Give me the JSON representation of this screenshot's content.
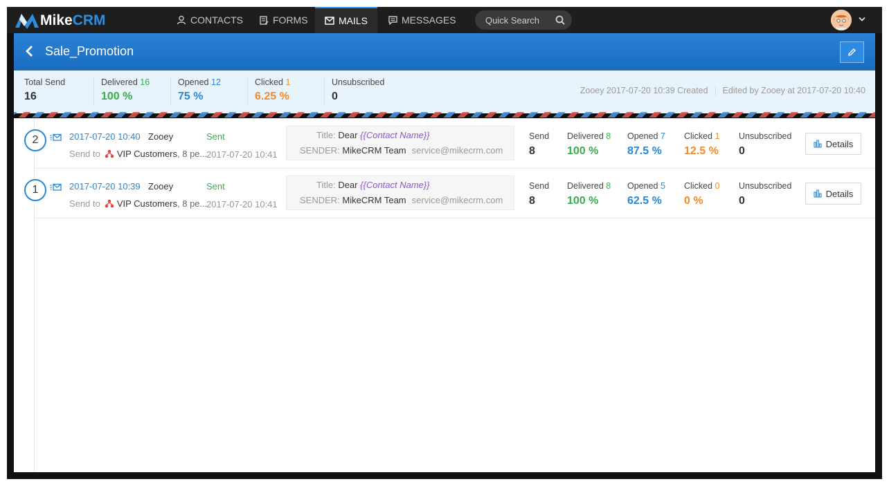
{
  "app": {
    "brand_part1": "Mike",
    "brand_part2": "CRM"
  },
  "nav": {
    "tabs": [
      {
        "label": "CONTACTS",
        "icon": "person-icon"
      },
      {
        "label": "FORMS",
        "icon": "form-icon"
      },
      {
        "label": "MAILS",
        "icon": "mail-icon",
        "active": true
      },
      {
        "label": "MESSAGES",
        "icon": "message-icon"
      }
    ],
    "search_placeholder": "Quick Search"
  },
  "page": {
    "title": "Sale_Promotion"
  },
  "summary": {
    "total_send_label": "Total Send",
    "total_send_value": "16",
    "delivered_label": "Delivered",
    "delivered_count": "16",
    "delivered_pct": "100 %",
    "opened_label": "Opened",
    "opened_count": "12",
    "opened_pct": "75 %",
    "clicked_label": "Clicked",
    "clicked_count": "1",
    "clicked_pct": "6.25 %",
    "unsub_label": "Unsubscribed",
    "unsub_value": "0",
    "created_text": "Zooey 2017-07-20 10:39 Created",
    "edited_text": "Edited by Zooey at 2017-07-20 10:40"
  },
  "campaigns": [
    {
      "index": "2",
      "date": "2017-07-20 10:40",
      "author": "Zooey",
      "status": "Sent",
      "send_to_label": "Send to",
      "group": "VIP Customers",
      "group_count": ", 8 pe...",
      "sent_date": "2017-07-20 10:41",
      "title_label": "Title:",
      "title_text": "Dear",
      "title_tag": "{{Contact Name}}",
      "sender_label": "SENDER:",
      "sender_name": "MikeCRM Team",
      "sender_email": "service@mikecrm.com",
      "send_label": "Send",
      "send_value": "8",
      "delivered_label": "Delivered",
      "delivered_count": "8",
      "delivered_pct": "100 %",
      "opened_label": "Opened",
      "opened_count": "7",
      "opened_pct": "87.5 %",
      "clicked_label": "Clicked",
      "clicked_count": "1",
      "clicked_pct": "12.5 %",
      "unsub_label": "Unsubscribed",
      "unsub_value": "0",
      "details_label": "Details"
    },
    {
      "index": "1",
      "date": "2017-07-20 10:39",
      "author": "Zooey",
      "status": "Sent",
      "send_to_label": "Send to",
      "group": "VIP Customers",
      "group_count": ", 8 pe...",
      "sent_date": "2017-07-20 10:41",
      "title_label": "Title:",
      "title_text": "Dear",
      "title_tag": "{{Contact Name}}",
      "sender_label": "SENDER:",
      "sender_name": "MikeCRM Team",
      "sender_email": "service@mikecrm.com",
      "send_label": "Send",
      "send_value": "8",
      "delivered_label": "Delivered",
      "delivered_count": "8",
      "delivered_pct": "100 %",
      "opened_label": "Opened",
      "opened_count": "5",
      "opened_pct": "62.5 %",
      "clicked_label": "Clicked",
      "clicked_count": "0",
      "clicked_pct": "0 %",
      "unsub_label": "Unsubscribed",
      "unsub_value": "0",
      "details_label": "Details"
    }
  ],
  "colors": {
    "accent": "#2a87d3",
    "green": "#3aac4b",
    "orange": "#f18a2c",
    "tag_purple": "#8e55d4"
  }
}
